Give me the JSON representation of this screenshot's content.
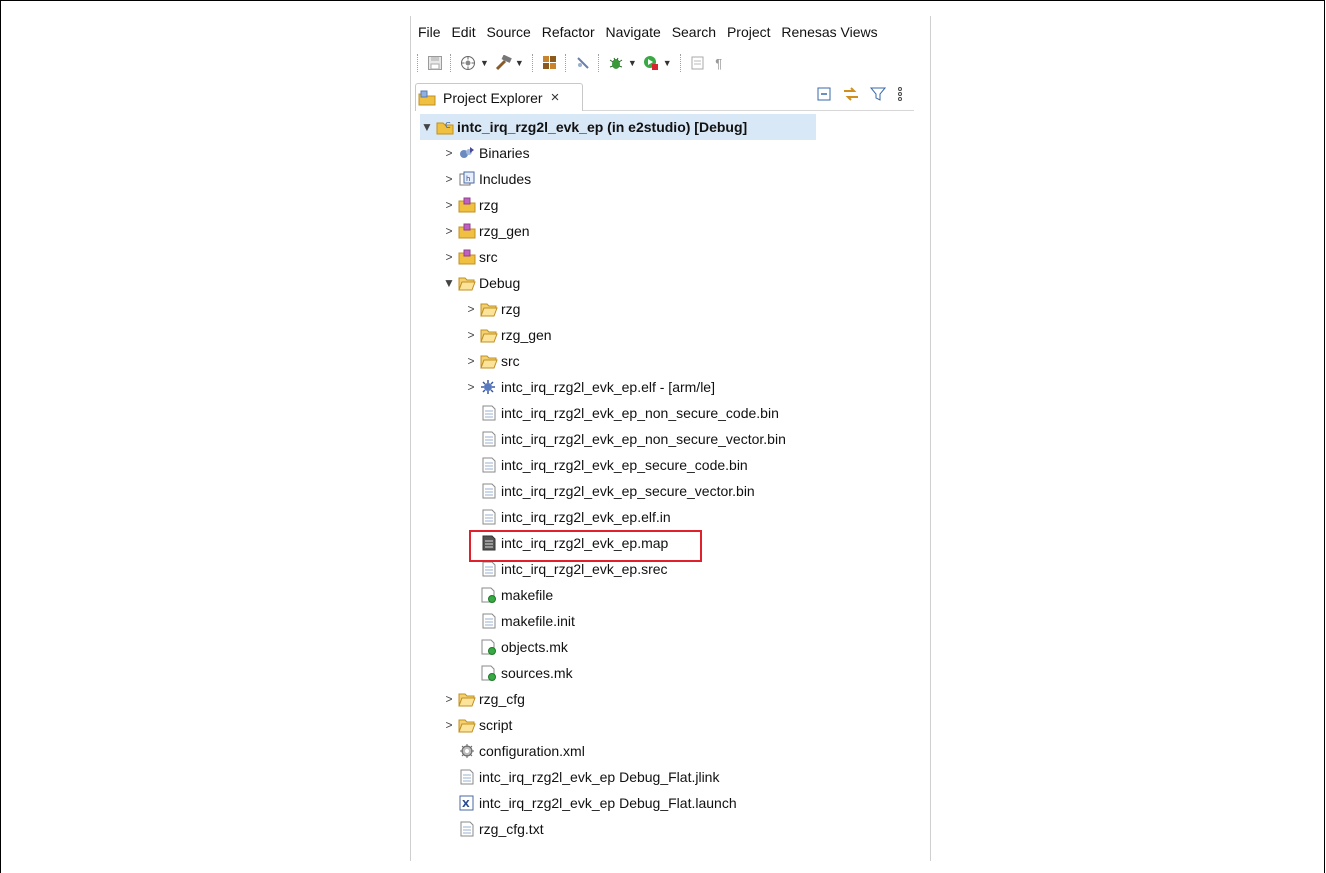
{
  "menu": [
    "File",
    "Edit",
    "Source",
    "Refactor",
    "Navigate",
    "Search",
    "Project",
    "Renesas Views"
  ],
  "view": {
    "tab_label": "Project Explorer",
    "close_glyph": "×"
  },
  "tree": {
    "root": "intc_irq_rzg2l_evk_ep (in e2studio) [Debug]",
    "items": [
      {
        "label": "Binaries",
        "icon": "binaries-icon"
      },
      {
        "label": "Includes",
        "icon": "includes-icon"
      },
      {
        "label": "rzg",
        "icon": "source-folder-icon"
      },
      {
        "label": "rzg_gen",
        "icon": "source-folder-icon"
      },
      {
        "label": "src",
        "icon": "source-folder-icon"
      },
      {
        "label": "Debug",
        "icon": "folder-icon"
      },
      {
        "label": "rzg",
        "icon": "folder-icon"
      },
      {
        "label": "rzg_gen",
        "icon": "folder-icon"
      },
      {
        "label": "src",
        "icon": "folder-icon"
      },
      {
        "label": "intc_irq_rzg2l_evk_ep.elf - [arm/le]",
        "icon": "elf-binary-icon"
      },
      {
        "label": "intc_irq_rzg2l_evk_ep_non_secure_code.bin",
        "icon": "file-icon"
      },
      {
        "label": "intc_irq_rzg2l_evk_ep_non_secure_vector.bin",
        "icon": "file-icon"
      },
      {
        "label": "intc_irq_rzg2l_evk_ep_secure_code.bin",
        "icon": "file-icon"
      },
      {
        "label": "intc_irq_rzg2l_evk_ep_secure_vector.bin",
        "icon": "file-icon"
      },
      {
        "label": "intc_irq_rzg2l_evk_ep.elf.in",
        "icon": "file-icon"
      },
      {
        "label": "intc_irq_rzg2l_evk_ep.map",
        "icon": "map-file-icon"
      },
      {
        "label": "intc_irq_rzg2l_evk_ep.srec",
        "icon": "file-icon"
      },
      {
        "label": "makefile",
        "icon": "makefile-icon"
      },
      {
        "label": "makefile.init",
        "icon": "file-icon"
      },
      {
        "label": "objects.mk",
        "icon": "makefile-icon"
      },
      {
        "label": "sources.mk",
        "icon": "makefile-icon"
      },
      {
        "label": "rzg_cfg",
        "icon": "folder-icon"
      },
      {
        "label": "script",
        "icon": "folder-icon"
      },
      {
        "label": "configuration.xml",
        "icon": "config-gear-icon"
      },
      {
        "label": "intc_irq_rzg2l_evk_ep Debug_Flat.jlink",
        "icon": "file-icon"
      },
      {
        "label": "intc_irq_rzg2l_evk_ep Debug_Flat.launch",
        "icon": "launch-file-icon"
      },
      {
        "label": "rzg_cfg.txt",
        "icon": "file-icon"
      }
    ]
  },
  "colors": {
    "selection": "#d9e8f7",
    "highlight": "#e0202a",
    "folder": "#f0c040"
  }
}
